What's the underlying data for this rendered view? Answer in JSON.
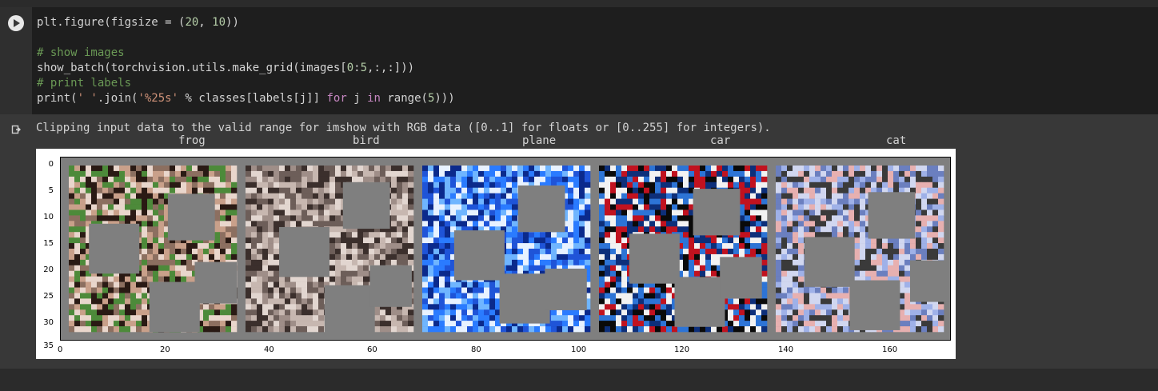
{
  "cell": {
    "code_lines": [
      "plt.figure(figsize = (20, 10))",
      "",
      "# show images",
      "show_batch(torchvision.utils.make_grid(images[0:5,:,:]))",
      "# print labels",
      "print(' '.join('%25s' % classes[labels[j]] for j in range(5)))"
    ]
  },
  "output": {
    "warning": "Clipping input data to the valid range for imshow with RGB data ([0..1] for floats or [0..255] for integers).",
    "labels": [
      "frog",
      "bird",
      "plane",
      "car",
      "cat"
    ]
  },
  "plot": {
    "y_ticks": [
      "0",
      "5",
      "10",
      "15",
      "20",
      "25",
      "30",
      "35"
    ],
    "x_ticks": [
      "0",
      "20",
      "40",
      "60",
      "80",
      "100",
      "120",
      "140",
      "160"
    ],
    "images": [
      {
        "name": "frog",
        "colors": [
          "#4d8a3a",
          "#c9a08a",
          "#2a1a14",
          "#8c6f60",
          "#e9d6cc"
        ]
      },
      {
        "name": "bird",
        "colors": [
          "#c7b7b0",
          "#9f8e88",
          "#3b2f2c",
          "#e2d6d0",
          "#6d5e59"
        ]
      },
      {
        "name": "plane",
        "colors": [
          "#1f54d8",
          "#2a7bff",
          "#0b2a8c",
          "#6fb5ff",
          "#e8f2ff"
        ]
      },
      {
        "name": "car",
        "colors": [
          "#0d2f7a",
          "#2d74d6",
          "#f2f2f2",
          "#0a0a0a",
          "#c1121f"
        ]
      },
      {
        "name": "cat",
        "colors": [
          "#9fb1e8",
          "#d1d7f0",
          "#6b7fbf",
          "#e7b0b0",
          "#3a3a3a"
        ]
      }
    ],
    "colors": {
      "grid_bg": "#7f7f7f",
      "border": "#000000"
    }
  }
}
